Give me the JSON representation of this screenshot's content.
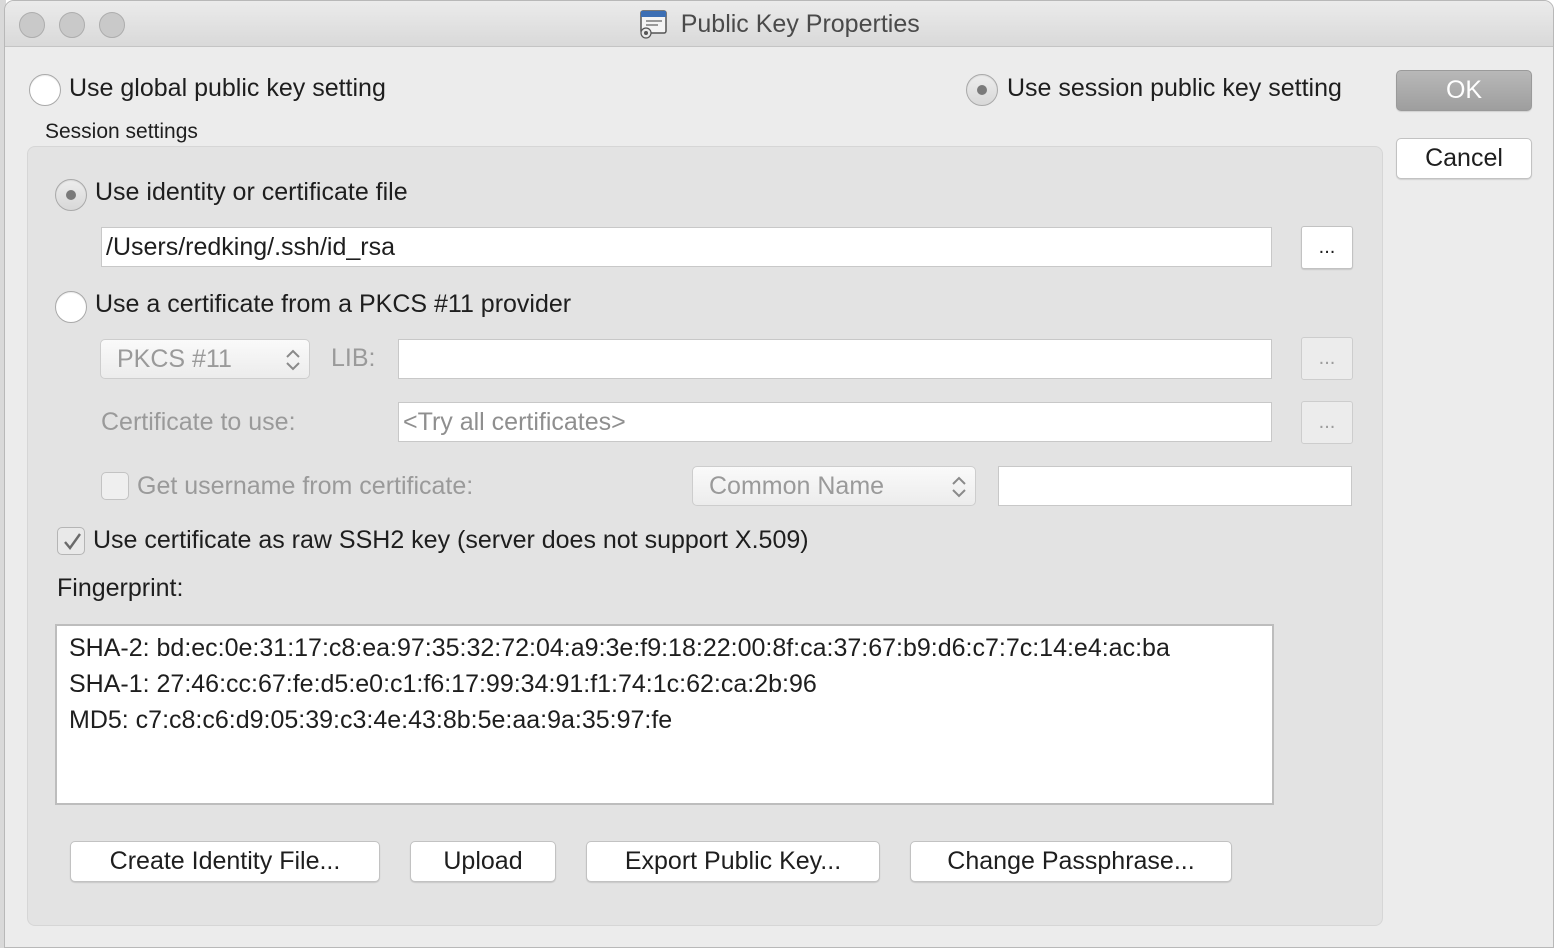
{
  "window": {
    "title": "Public Key Properties"
  },
  "top": {
    "global_radio_label": "Use global public key setting",
    "session_radio_label": "Use session public key setting",
    "ok_label": "OK",
    "cancel_label": "Cancel",
    "session_settings_label": "Session settings"
  },
  "identity": {
    "radio_label": "Use identity or certificate file",
    "path_value": "/Users/redking/.ssh/id_rsa",
    "browse_label": "..."
  },
  "pkcs": {
    "radio_label": "Use a certificate from a PKCS #11 provider",
    "provider_selected": "PKCS #11",
    "lib_label": "LIB:",
    "lib_value": "",
    "lib_browse_label": "...",
    "cert_label": "Certificate to use:",
    "cert_placeholder": "<Try all certificates>",
    "cert_browse_label": "...",
    "username_checkbox_label": "Get username from certificate:",
    "username_field_selected": "Common Name",
    "username_value": ""
  },
  "raw_ssh2": {
    "checkbox_label": "Use certificate as raw SSH2 key (server does not support X.509)",
    "checked": true
  },
  "fingerprint": {
    "label": "Fingerprint:",
    "lines": [
      "SHA-2: bd:ec:0e:31:17:c8:ea:97:35:32:72:04:a9:3e:f9:18:22:00:8f:ca:37:67:b9:d6:c7:7c:14:e4:ac:ba",
      "SHA-1: 27:46:cc:67:fe:d5:e0:c1:f6:17:99:34:91:f1:74:1c:62:ca:2b:96",
      "MD5: c7:c8:c6:d9:05:39:c3:4e:43:8b:5e:aa:9a:35:97:fe"
    ]
  },
  "buttons": {
    "create_identity": "Create Identity File...",
    "upload": "Upload",
    "export_public_key": "Export Public Key...",
    "change_passphrase": "Change Passphrase..."
  },
  "colors": {
    "window_bg": "#ececec",
    "group_bg": "#e3e3e3",
    "ok_bg": "#a8a8a8"
  }
}
